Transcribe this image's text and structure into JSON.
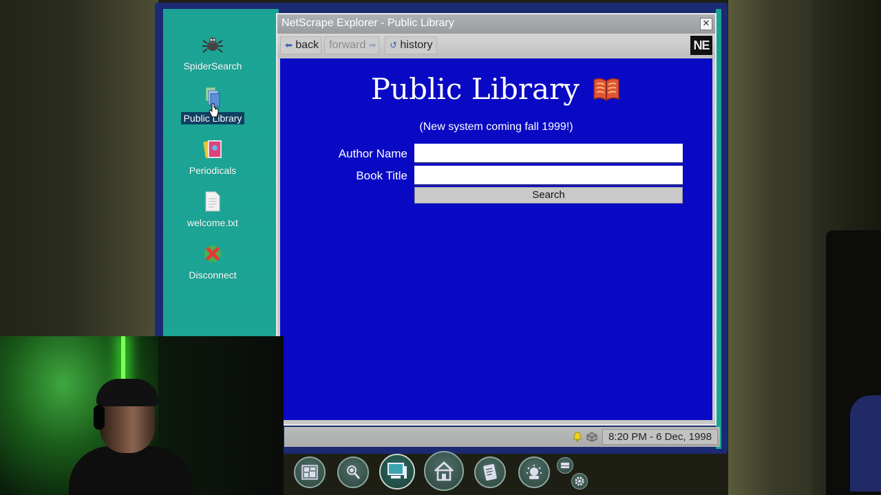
{
  "desktop": {
    "icons": [
      {
        "label": "SpiderSearch",
        "icon": "spider-icon"
      },
      {
        "label": "Public Library",
        "icon": "books-icon",
        "selected": true
      },
      {
        "label": "Periodicals",
        "icon": "magazines-icon"
      },
      {
        "label": "welcome.txt",
        "icon": "text-file-icon"
      },
      {
        "label": "Disconnect",
        "icon": "disconnect-icon"
      }
    ]
  },
  "window": {
    "title": "NetScrape Explorer - Public Library",
    "close_label": "✕",
    "toolbar": {
      "back_label": "back",
      "forward_label": "forward",
      "history_label": "history",
      "logo_text": "NE"
    }
  },
  "page": {
    "heading": "Public Library",
    "subtitle": "(New system coming fall 1999!)",
    "form": {
      "author_label": "Author Name",
      "author_value": "",
      "title_label": "Book Title",
      "title_value": "",
      "search_label": "Search"
    }
  },
  "statusbar": {
    "clock": "8:20 PM - 6 Dec, 1998"
  },
  "dock": {
    "items": [
      "bulletin-board-icon",
      "detective-icon",
      "computer-icon",
      "home-icon",
      "notebook-icon",
      "idea-icon",
      "settings-icon"
    ]
  },
  "colors": {
    "desktop": "#1aa394",
    "page_background": "#0808c4",
    "window_chrome": "#c8c8c8"
  }
}
